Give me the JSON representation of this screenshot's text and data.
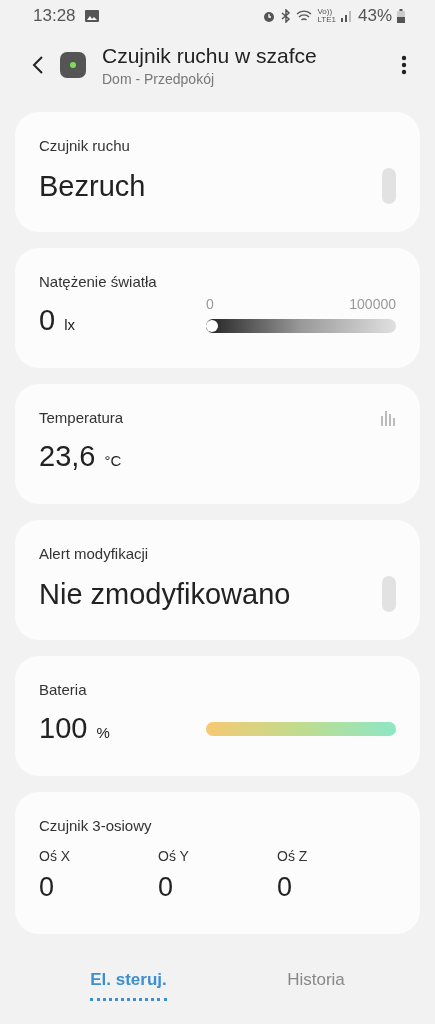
{
  "status_bar": {
    "time": "13:28",
    "network_lines": [
      "Vo))",
      "LTE1"
    ],
    "battery": "43%"
  },
  "header": {
    "title": "Czujnik ruchu w szafce",
    "subtitle": "Dom - Przedpokój"
  },
  "cards": [
    {
      "kind": "state",
      "label": "Czujnik ruchu",
      "value": "Bezruch",
      "on": false
    },
    {
      "kind": "range",
      "label": "Natężenie światła",
      "value": "0",
      "unit": "lx",
      "min": "0",
      "max": "100000",
      "level": 0
    },
    {
      "kind": "value",
      "label": "Temperatura",
      "value": "23,6",
      "unit": "°C"
    },
    {
      "kind": "state",
      "label": "Alert modyfikacji",
      "value": "Nie zmodyfikowano",
      "on": false
    },
    {
      "kind": "battery",
      "label": "Bateria",
      "value": "100",
      "unit": "%",
      "level": 1
    },
    {
      "kind": "axes",
      "label": "Czujnik 3-osiowy",
      "axes": [
        {
          "name": "Oś X",
          "value": "0"
        },
        {
          "name": "Oś Y",
          "value": "0"
        },
        {
          "name": "Oś Z",
          "value": "0"
        }
      ]
    }
  ],
  "tabs": [
    {
      "label": "El. steruj.",
      "selected": true
    },
    {
      "label": "Historia",
      "selected": false
    }
  ]
}
